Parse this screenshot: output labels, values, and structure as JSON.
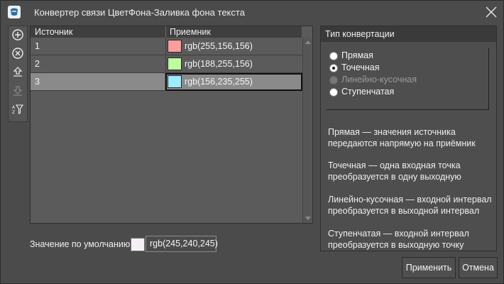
{
  "window": {
    "title": "Конвертер связи ЦветФона-Заливка фона текста"
  },
  "toolbar": {
    "buttons": [
      {
        "name": "add-icon"
      },
      {
        "name": "remove-icon"
      },
      {
        "name": "move-up-icon"
      },
      {
        "name": "move-down-icon",
        "disabled": true
      },
      {
        "name": "sort-filter-icon"
      }
    ]
  },
  "table": {
    "headers": {
      "source": "Источник",
      "target": "Приемник"
    },
    "rows": [
      {
        "source": "1",
        "target": "rgb(255,156,156)",
        "color": "#ff9c9c"
      },
      {
        "source": "2",
        "target": "rgb(188,255,156)",
        "color": "#bcff9c"
      },
      {
        "source": "3",
        "target": "rgb(156,235,255)",
        "color": "#9cebff",
        "selected": true
      }
    ]
  },
  "default_value": {
    "label": "Значение по умолчанию",
    "value": "rgb(245,240,245)",
    "color": "#f5f0f5"
  },
  "conversion": {
    "title": "Тип конвертации",
    "options": [
      {
        "label": "Прямая",
        "checked": false,
        "disabled": false
      },
      {
        "label": "Точечная",
        "checked": true,
        "disabled": false
      },
      {
        "label": "Линейно-кусочная",
        "checked": false,
        "disabled": true
      },
      {
        "label": "Ступенчатая",
        "checked": false,
        "disabled": false
      }
    ],
    "descriptions": [
      "Прямая — значения источника передаются напрямую на приёмник",
      "Точечная — одна входная точка преобразуется в одну выходную",
      "Линейно-кусочная — входной интервал преобразуется в выходной интервал",
      "Ступенчатая — входной интервал преобразуется в выходную точку"
    ]
  },
  "buttons": {
    "apply": "Применить",
    "cancel": "Отмена"
  }
}
